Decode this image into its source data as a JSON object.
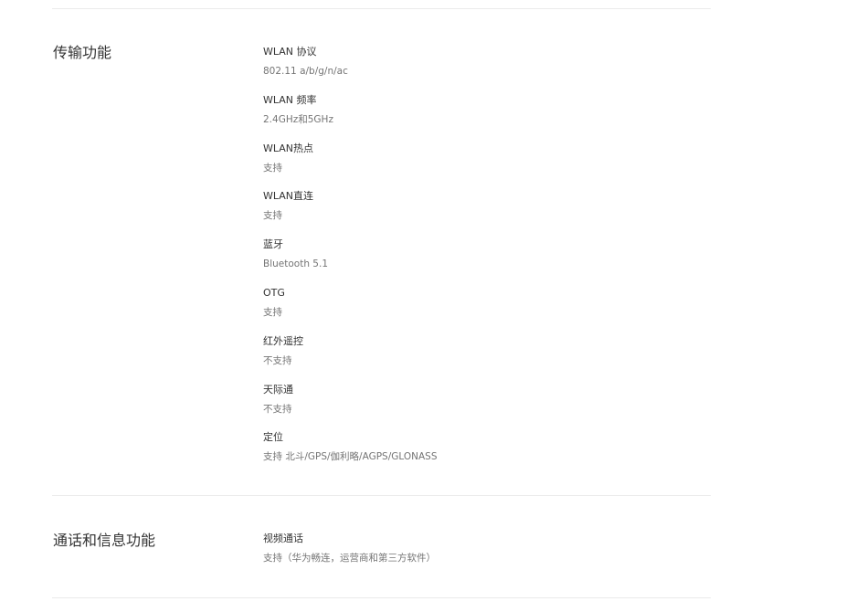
{
  "sections": [
    {
      "title": "传输功能",
      "items": [
        {
          "label": "WLAN 协议",
          "value": "802.11 a/b/g/n/ac"
        },
        {
          "label": "WLAN 频率",
          "value": "2.4GHz和5GHz"
        },
        {
          "label": "WLAN热点",
          "value": "支持"
        },
        {
          "label": "WLAN直连",
          "value": "支持"
        },
        {
          "label": "蓝牙",
          "value": "Bluetooth 5.1"
        },
        {
          "label": "OTG",
          "value": "支持"
        },
        {
          "label": "红外遥控",
          "value": "不支持"
        },
        {
          "label": "天际通",
          "value": "不支持"
        },
        {
          "label": "定位",
          "value": "支持 北斗/GPS/伽利略/AGPS/GLONASS"
        }
      ]
    },
    {
      "title": "通话和信息功能",
      "items": [
        {
          "label": "视频通话",
          "value": "支持（华为畅连，运营商和第三方软件）"
        }
      ]
    }
  ]
}
